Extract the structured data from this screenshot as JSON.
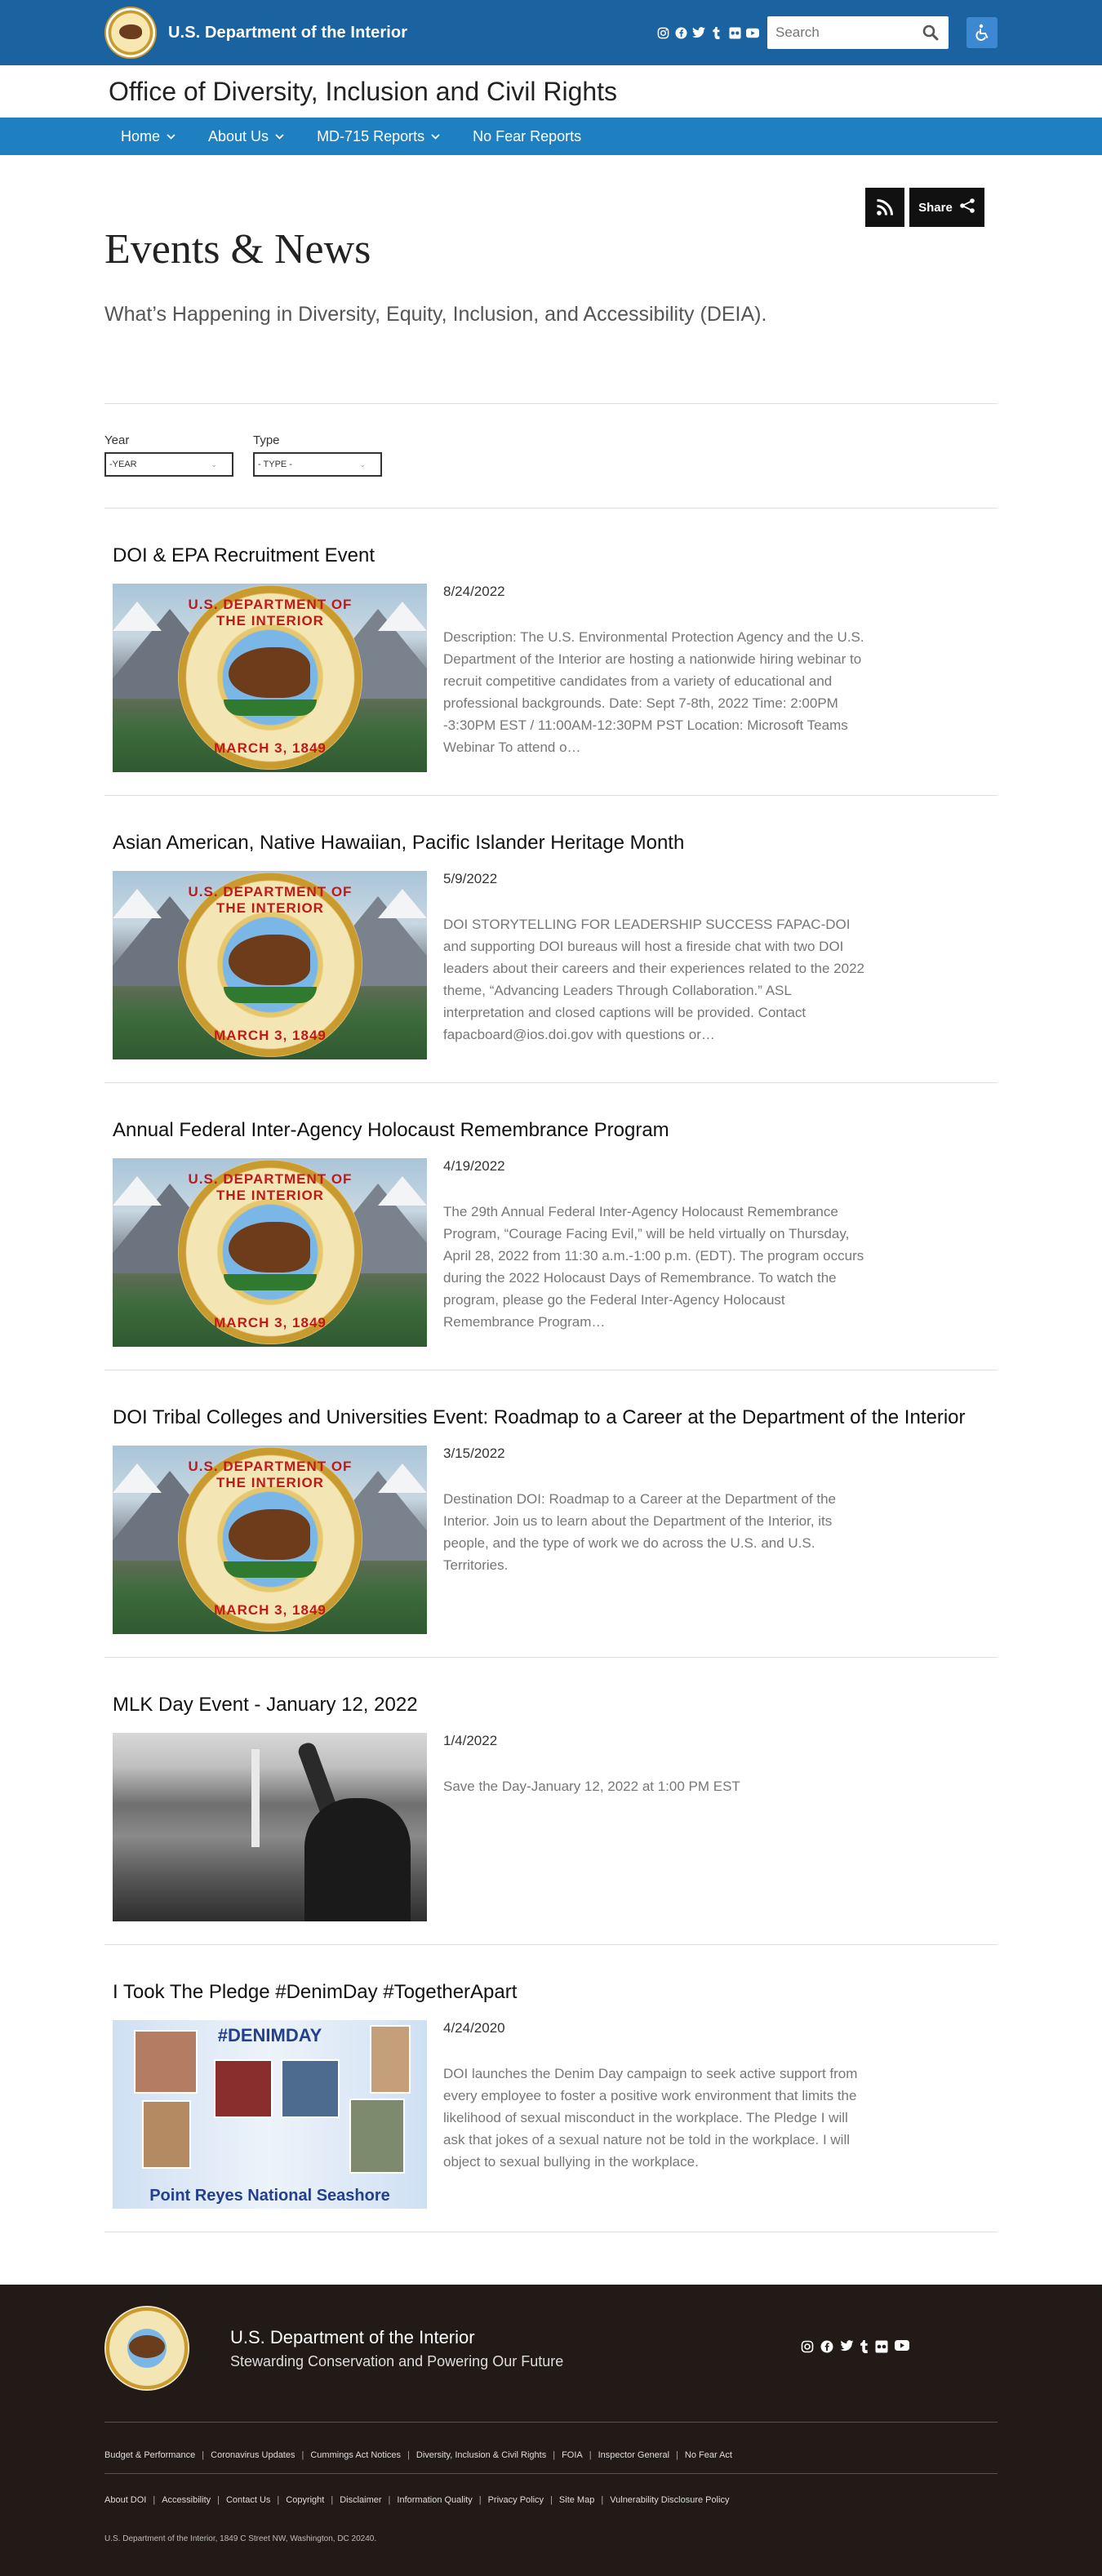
{
  "header": {
    "site_title": "U.S. Department of the Interior",
    "search_placeholder": "Search",
    "social_icons": [
      "instagram-icon",
      "facebook-icon",
      "twitter-icon",
      "tumblr-icon",
      "flickr-icon",
      "youtube-icon"
    ]
  },
  "office": {
    "title": "Office of Diversity, Inclusion and Civil Rights"
  },
  "nav": {
    "items": [
      {
        "label": "Home",
        "has_dropdown": true
      },
      {
        "label": "About Us",
        "has_dropdown": true
      },
      {
        "label": "MD-715 Reports",
        "has_dropdown": true
      },
      {
        "label": "No Fear Reports",
        "has_dropdown": false
      }
    ]
  },
  "main": {
    "share_label": "Share",
    "title": "Events & News",
    "subhead": "What’s Happening in Diversity, Equity, Inclusion, and Accessibility (DEIA).",
    "filters": {
      "year": {
        "label": "Year",
        "value": "-YEAR"
      },
      "type": {
        "label": "Type",
        "value": "- TYPE -"
      }
    },
    "events": [
      {
        "title": "DOI & EPA Recruitment Event",
        "date": "8/24/2022",
        "image": "doi-seal",
        "description": "Description:  The U.S. Environmental Protection Agency and the U.S. Department of the Interior are hosting a nationwide hiring webinar to recruit competitive candidates from a variety of educational and professional backgrounds. Date: Sept 7-8th, 2022 Time:  2:00PM -3:30PM EST / 11:00AM-12:30PM PST Location:  Microsoft Teams Webinar To attend o…"
      },
      {
        "title": "Asian American, Native Hawaiian, Pacific Islander Heritage Month",
        "date": "5/9/2022",
        "image": "doi-seal",
        "description": "DOI STORYTELLING FOR LEADERSHIP SUCCESS FAPAC-DOI and supporting DOI bureaus will host a fireside chat with two DOI leaders about their careers and their experiences related to the 2022 theme, “Advancing Leaders Through Collaboration.” ASL interpretation and closed captions will be provided. Contact fapacboard@ios.doi.gov with questions or…"
      },
      {
        "title": "Annual Federal Inter-Agency Holocaust Remembrance Program",
        "date": "4/19/2022",
        "image": "doi-seal",
        "description": "The 29th Annual Federal Inter-Agency Holocaust Remembrance Program, “Courage Facing Evil,” will be held virtually on Thursday, April 28, 2022 from 11:30 a.m.-1:00 p.m. (EDT).  The program occurs during the 2022 Holocaust Days of Remembrance.  To watch the program, please go the Federal Inter-Agency Holocaust Remembrance Program…"
      },
      {
        "title": "DOI Tribal Colleges and Universities Event: Roadmap to a Career at the Department of the Interior",
        "date": "3/15/2022",
        "image": "doi-seal",
        "description": "Destination DOI: Roadmap to a Career at the Department of the Interior. Join us to learn about the Department of the Interior, its people, and the type of work we do across the U.S. and U.S. Territories."
      },
      {
        "title": "MLK Day Event - January 12, 2022",
        "date": "1/4/2022",
        "image": "mlk-photo",
        "description": "Save the Day-January 12, 2022 at 1:00 PM EST"
      },
      {
        "title": "I Took The Pledge #DenimDay #TogetherApart",
        "date": "4/24/2020",
        "image": "denim-day-collage",
        "image_header": "#DENIMDAY",
        "image_footer": "Point Reyes National Seashore",
        "description": "DOI launches the Denim Day campaign to seek active support from every employee to foster a positive work environment that limits the likelihood of sexual misconduct in the workplace.    The Pledge I will ask that jokes of a sexual nature not be told in the workplace. I will object to sexual bullying in the workplace."
      }
    ],
    "seal_text": {
      "top": "U.S. DEPARTMENT OF THE INTERIOR",
      "bottom": "MARCH 3, 1849"
    }
  },
  "footer": {
    "org_name": "U.S. Department of the Interior",
    "tagline": "Stewarding Conservation and Powering Our Future",
    "links_row1": [
      "Budget & Performance",
      "Coronavirus Updates",
      "Cummings Act Notices",
      "Diversity, Inclusion & Civil Rights",
      "FOIA",
      "Inspector General",
      "No Fear Act"
    ],
    "links_row2": [
      "About DOI",
      "Accessibility",
      "Contact Us",
      "Copyright",
      "Disclaimer",
      "Information Quality",
      "Privacy Policy",
      "Site Map",
      "Vulnerability Disclosure Policy"
    ],
    "address": "U.S. Department of the Interior, 1849 C Street NW, Washington, DC 20240."
  },
  "colors": {
    "header_bg": "#1b62a0",
    "nav_bg": "#1e7fc1",
    "footer_bg": "#211a17"
  }
}
